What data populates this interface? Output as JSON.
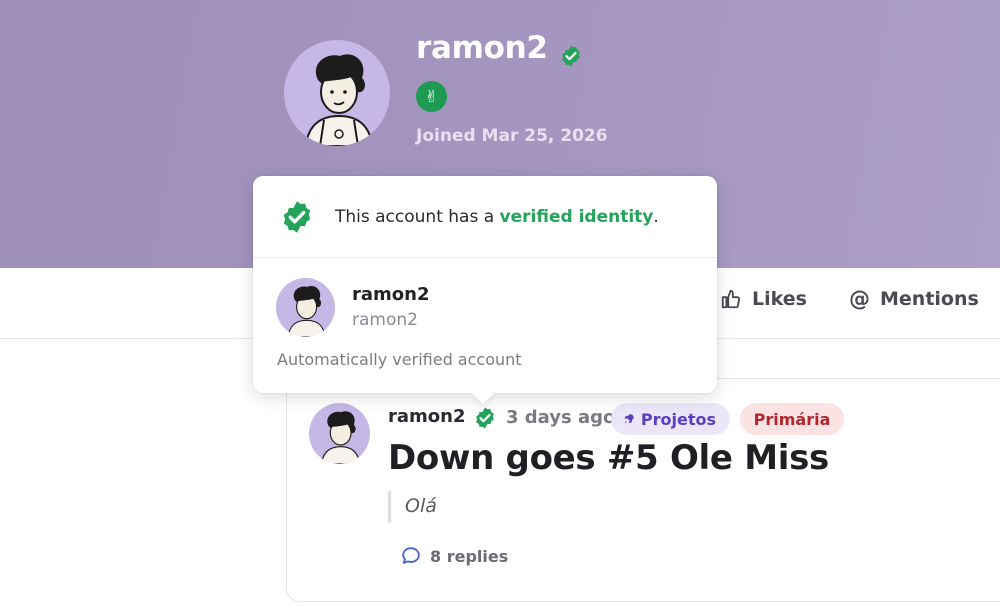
{
  "profile": {
    "username": "ramon2",
    "joined": "Joined Mar 25, 2026",
    "banner_color": "#a094be",
    "avatar_bg": "#c5b7e6",
    "verified_color": "#24a35a",
    "badge_icon": "peace-hand-icon"
  },
  "tabs": [
    {
      "label": "Likes",
      "icon": "thumbs-up-icon"
    },
    {
      "label": "Mentions",
      "icon": "at-sign-icon"
    }
  ],
  "popover": {
    "text_prefix": "This account has a ",
    "text_highlight": "verified identity",
    "text_suffix": ".",
    "name": "ramon2",
    "handle": "ramon2",
    "note": "Automatically verified account"
  },
  "post": {
    "user": "ramon2",
    "time": "3 days ago",
    "tags": [
      {
        "label": "Projetos",
        "icon": "rocket-icon",
        "color": "#5a3fc0",
        "bg": "#ebe6f8"
      },
      {
        "label": "Primária",
        "color": "#b2262e",
        "bg": "#fbe3e3"
      }
    ],
    "title": "Down goes #5 Ole Miss",
    "quote": "Olá",
    "replies": "8 replies",
    "replies_icon": "speech-bubble-icon"
  }
}
